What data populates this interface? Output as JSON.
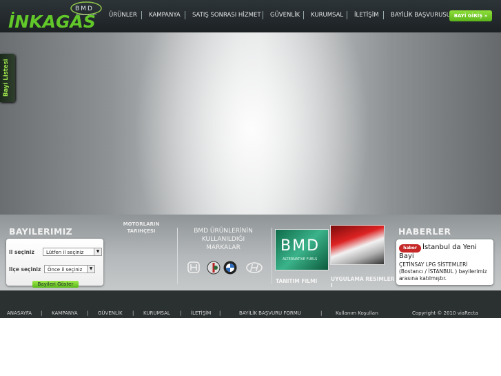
{
  "header": {
    "logo_text": "İNKAGAS",
    "logo_sub": "BMD",
    "logo_tag": "ALTERNATIVE FUELS",
    "nav": [
      "ÜRÜNLER",
      "KAMPANYA",
      "SATIŞ SONRASI HİZMET",
      "GÜVENLİK",
      "KURUMSAL",
      "İLETİŞİM",
      "BAYİLİK BAŞVURUSU"
    ],
    "login_label": "BAYİ GİRİŞ »"
  },
  "side_tab": {
    "label": "Bayi Listesi"
  },
  "dealers": {
    "title": "BAYILERIMIZ",
    "city_label": "Il seçiniz",
    "city_value": "Lütfen il seçiniz",
    "district_label": "Ilçe seçiniz",
    "district_value": "Önce il seçiniz",
    "button": "Bayileri Göster"
  },
  "motors": {
    "line1": "MOTORLARIN",
    "line2": "TARIHÇESI"
  },
  "brands": {
    "line1": "BMD ÜRÜNLERİNİN",
    "line2": "KULLANILDIĞI",
    "line3": "MARKALAR"
  },
  "media": {
    "film_caption": "TANITIM FILMI",
    "bmd_logo": "BMD",
    "bmd_tag": "ALTERNATIVE FUELS",
    "photos_caption": "UYGULAMA RESIMLER",
    "photos_caption2": "I"
  },
  "news": {
    "title": "HABERLER",
    "badge": "haber",
    "headline_1": "İstanbul da Yeni",
    "headline_2": "Bayi",
    "body": "ÇETİNSAY LPG SİSTEMLERİ (Bostancı / İSTANBUL ) bayilerimiz arasına katılmıştır."
  },
  "footer": {
    "links": [
      "ANASAYFA",
      "KAMPANYA",
      "GÜVENLİK",
      "KURUMSAL",
      "İLETİŞİM",
      "BAYİLİK BAŞVURU FORMU",
      "Kullanım Koşulları"
    ],
    "copyright": "Copyright © 2010 viaRecta"
  },
  "colors": {
    "accent_green": "#6fca24",
    "header_bg": "#22282b",
    "footer_bg": "#2b3031"
  }
}
